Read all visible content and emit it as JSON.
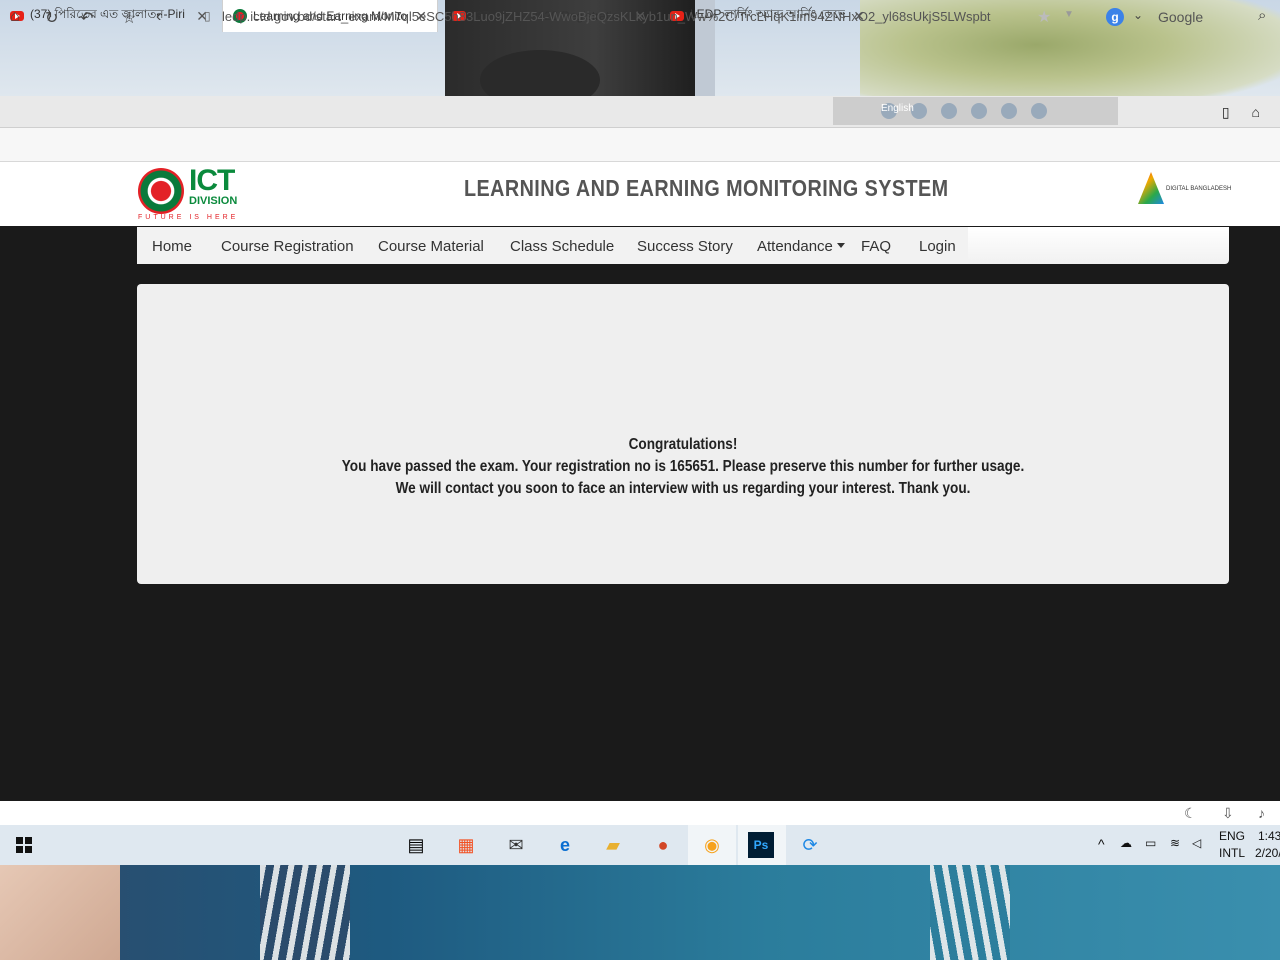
{
  "browser": {
    "tabs": [
      {
        "label": "(37) পিরিতের এত জ্বালাতন-Piri",
        "icon": "youtube-icon",
        "active": false
      },
      {
        "label": "Learning and Earning Monitor",
        "icon": "bd-flag-icon",
        "active": true
      },
      {
        "label": "(37) LEDP 2020 Registration Pr",
        "icon": "youtube-icon",
        "active": false
      },
      {
        "label": "LEDP লার্নিং অ্যান্ড আর্নিং ডেভে",
        "icon": "youtube-icon",
        "active": false
      }
    ],
    "ime_label": "English",
    "url": "ledp.ictd.gov.bd/start_exam/M7ql5eSC5h83Luo9jZHZ54-WwoBjeQzsKLkyb1un_Ww%2C/TrcLHqK1im94ZNHxO2_yl68sUkjS5LWspbt",
    "search_engine_label": "Google"
  },
  "site": {
    "logo_ict": "ICT",
    "logo_division": "DIVISION",
    "logo_tagline": "FUTURE IS HERE",
    "title": "LEARNING AND EARNING MONITORING SYSTEM",
    "partner_logo_title": "DIGITAL BANGLADESH",
    "nav": {
      "home": "Home",
      "course_registration": "Course Registration",
      "course_material": "Course Material",
      "class_schedule": "Class Schedule",
      "success_story": "Success Story",
      "attendance": "Attendance",
      "faq": "FAQ",
      "login": "Login"
    },
    "message": {
      "line1": "Congratulations!",
      "line2": "You have passed the exam. Your registration no is 165651. Please preserve this number for further usage.",
      "line3": "We will contact you soon to face an interview with us regarding your interest. Thank you."
    }
  },
  "taskbar": {
    "lang_top": "ENG",
    "lang_bottom": "INTL",
    "time": "1:43",
    "date": "2/20/"
  }
}
